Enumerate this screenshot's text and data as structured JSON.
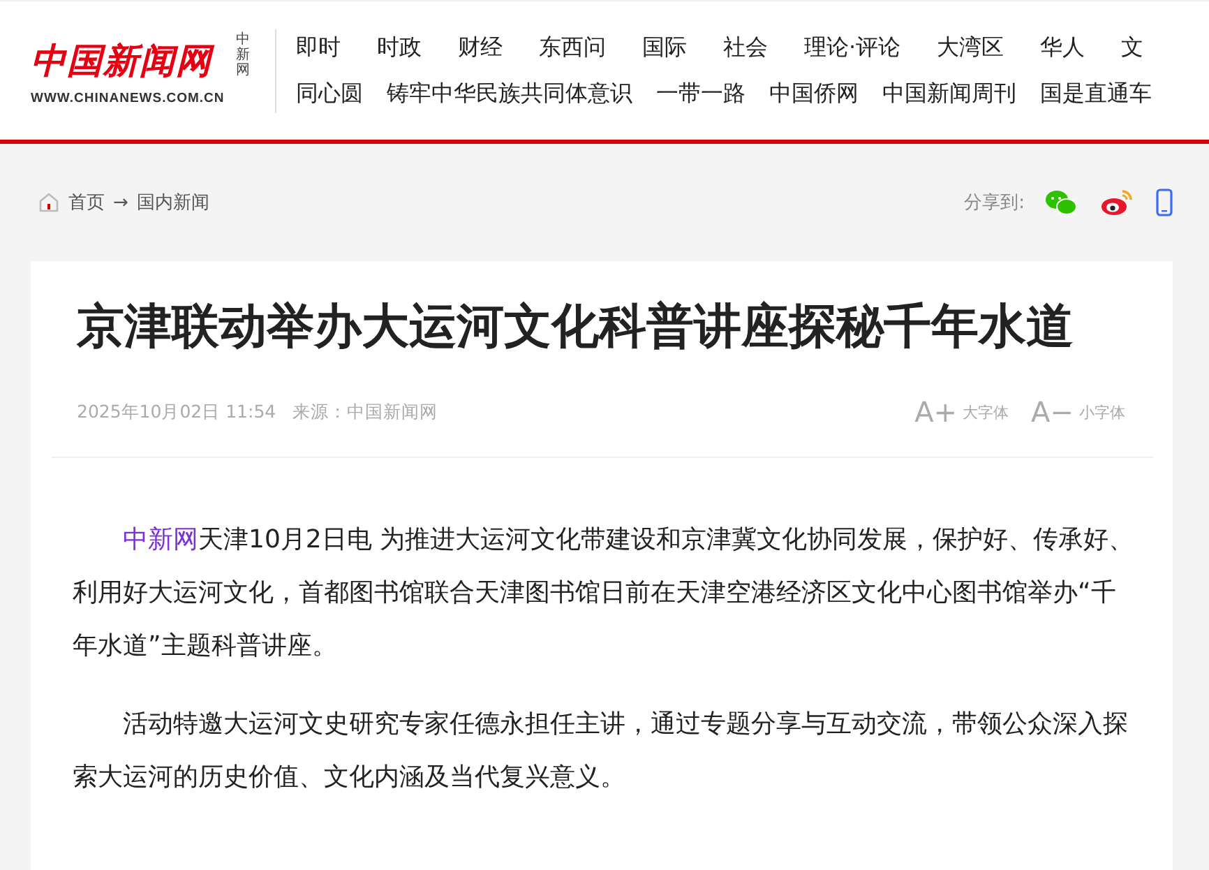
{
  "logo": {
    "name": "中国新闻网",
    "short": "中新网",
    "url": "WWW.CHINANEWS.COM.CN"
  },
  "nav_rows": [
    [
      "即时",
      "时政",
      "财经",
      "东西问",
      "国际",
      "社会",
      "理论·评论",
      "大湾区",
      "华人",
      "文"
    ],
    [
      "同心圆",
      "铸牢中华民族共同体意识",
      "一带一路",
      "中国侨网",
      "中国新闻周刊",
      "国是直通车"
    ]
  ],
  "breadcrumb": {
    "home": "首页",
    "separator": "→",
    "section": "国内新闻"
  },
  "share": {
    "label": "分享到:"
  },
  "article": {
    "title": "京津联动举办大运河文化科普讲座探秘千年水道",
    "datetime": "2025年10月02日 11:54",
    "source": "来源：中国新闻网",
    "font_buttons": [
      {
        "symbol": "A+",
        "label": "大字体"
      },
      {
        "symbol": "A−",
        "label": "小字体"
      }
    ],
    "paragraphs": [
      {
        "link": "中新网",
        "text": "天津10月2日电 为推进大运河文化带建设和京津冀文化协同发展，保护好、传承好、利用好大运河文化，首都图书馆联合天津图书馆日前在天津空港经济区文化中心图书馆举办“千年水道”主题科普讲座。"
      },
      {
        "text": "活动特邀大运河文史研究专家任德永担任主讲，通过专题分享与互动交流，带领公众深入探索大运河的历史价值、文化内涵及当代复兴意义。"
      }
    ]
  }
}
